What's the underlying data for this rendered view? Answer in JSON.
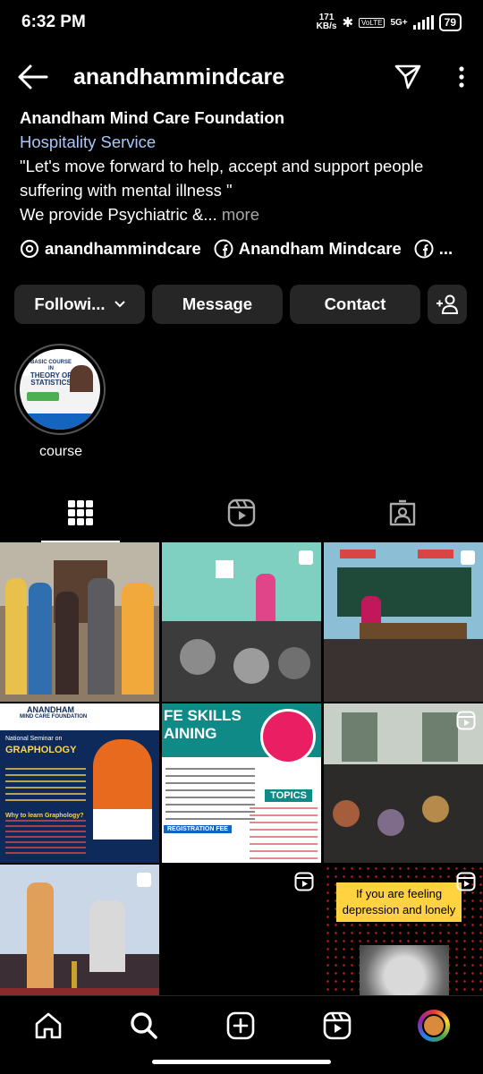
{
  "status_bar": {
    "time": "6:32 PM",
    "speed_value": "171",
    "speed_unit": "KB/s",
    "volte": "VoLTE",
    "network": "5G+",
    "battery": "79"
  },
  "top_bar": {
    "title": "anandhammindcare"
  },
  "profile": {
    "name": "Anandham Mind Care Foundation",
    "category": "Hospitality Service",
    "bio_line1": "\"Let's move forward to help, accept and support people suffering with mental illness \"",
    "bio_line2": "We provide Psychiatric &...",
    "more_label": "more"
  },
  "links": [
    {
      "icon": "threads-icon",
      "label": "anandhammindcare"
    },
    {
      "icon": "facebook-icon",
      "label": "Anandham Mindcare"
    },
    {
      "icon": "facebook-icon",
      "label": "..."
    }
  ],
  "buttons": {
    "following": "Followi...",
    "message": "Message",
    "contact": "Contact"
  },
  "highlights": [
    {
      "label": "course",
      "cover_text_1": "BASIC COURSE IN",
      "cover_text_2": "THEORY OF STATISTICS"
    }
  ],
  "tabs": [
    {
      "name": "posts",
      "icon": "grid-icon",
      "active": true
    },
    {
      "name": "reels",
      "icon": "reels-icon",
      "active": false
    },
    {
      "name": "tagged",
      "icon": "tagged-icon",
      "active": false
    }
  ],
  "posts": [
    {
      "type": "photo",
      "multi": false,
      "text_lines": []
    },
    {
      "type": "photo",
      "multi": true,
      "text_lines": []
    },
    {
      "type": "photo",
      "multi": true,
      "text_lines": []
    },
    {
      "type": "poster",
      "multi": true,
      "text_lines": [
        "ANANDHAM",
        "MIND CARE FOUNDATION",
        "National Seminar on",
        "GRAPHOLOGY",
        "Why to learn Graphology?"
      ]
    },
    {
      "type": "poster",
      "multi": false,
      "text_lines": [
        "FE SKILLS",
        "AINING",
        "TOPICS",
        "REGISTRATION FEE"
      ]
    },
    {
      "type": "reel",
      "multi": false,
      "text_lines": []
    },
    {
      "type": "photo",
      "multi": true,
      "text_lines": []
    },
    {
      "type": "reel",
      "multi": false,
      "text_lines": []
    },
    {
      "type": "reel",
      "multi": false,
      "text_lines": [
        "If you are feeling",
        "depression and lonely"
      ]
    }
  ],
  "bottom_nav": [
    {
      "name": "home",
      "icon": "home-icon"
    },
    {
      "name": "search",
      "icon": "search-icon"
    },
    {
      "name": "create",
      "icon": "create-icon"
    },
    {
      "name": "reels",
      "icon": "reels-icon"
    },
    {
      "name": "profile",
      "icon": "avatar"
    }
  ],
  "colors": {
    "background": "#000000",
    "button_bg": "#262626",
    "category": "#a8c7fa",
    "muted": "#a8a8a8"
  }
}
